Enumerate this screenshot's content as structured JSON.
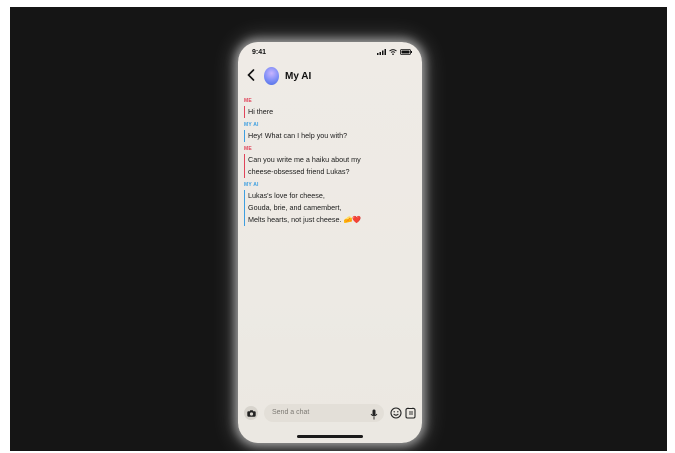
{
  "status": {
    "time": "9:41"
  },
  "header": {
    "title": "My AI"
  },
  "messages": [
    {
      "sender": "ME",
      "lines": [
        "Hi there"
      ]
    },
    {
      "sender": "MY AI",
      "lines": [
        "Hey! What can I help you with?"
      ]
    },
    {
      "sender": "ME",
      "lines": [
        "Can you write me a haiku about my",
        "cheese-obsessed friend Lukas?"
      ]
    },
    {
      "sender": "MY AI",
      "lines": [
        "Lukas's love for cheese,",
        "Gouda, brie, and camembert,",
        "Melts hearts, not just cheese. 🧀❤️"
      ]
    }
  ],
  "composer": {
    "placeholder": "Send a chat"
  },
  "colors": {
    "me": "#e0445a",
    "ai": "#3d9ee0",
    "background": "#151515",
    "phone": "#eeeae4"
  },
  "icons": [
    "back-chevron-icon",
    "avatar",
    "camera-icon",
    "microphone-icon",
    "emoji-icon",
    "sticker-icon",
    "signal-icon",
    "wifi-icon",
    "battery-icon"
  ]
}
